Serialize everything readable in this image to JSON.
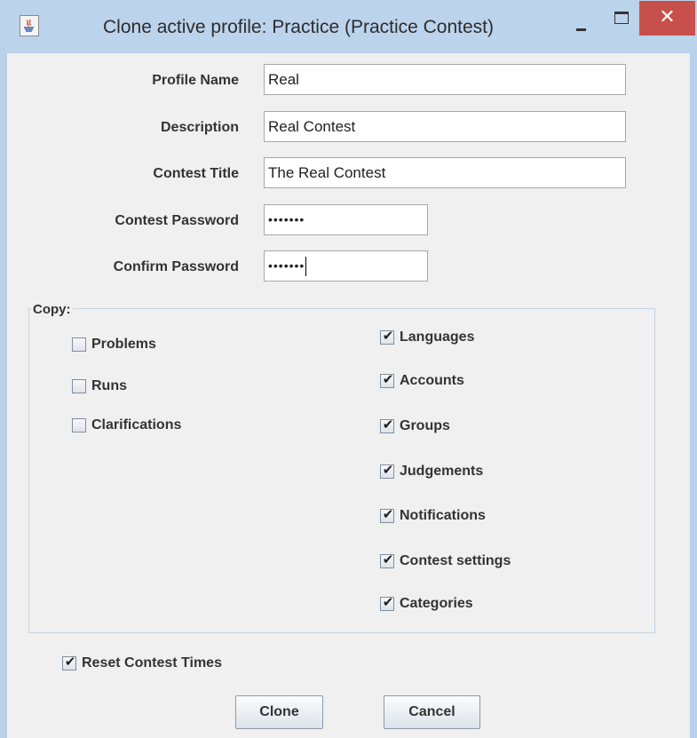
{
  "window": {
    "title": "Clone active profile: Practice (Practice Contest)",
    "close_glyph": "✕",
    "icons": [
      "java-icon",
      "minimize-icon",
      "maximize-icon",
      "close-icon"
    ]
  },
  "form": {
    "profile_name_label": "Profile Name",
    "profile_name_value": "Real",
    "description_label": "Description",
    "description_value": "Real Contest",
    "contest_title_label": "Contest Title",
    "contest_title_value": "The Real Contest",
    "contest_password_label": "Contest Password",
    "contest_password_value": "•••••••",
    "confirm_password_label": "Confirm Password",
    "confirm_password_value": "•••••••"
  },
  "copy": {
    "title": "Copy:",
    "left": [
      {
        "label": "Problems",
        "checked": false
      },
      {
        "label": "Runs",
        "checked": false
      },
      {
        "label": "Clarifications",
        "checked": false
      }
    ],
    "right": [
      {
        "label": "Languages",
        "checked": true
      },
      {
        "label": "Accounts",
        "checked": true
      },
      {
        "label": "Groups",
        "checked": true
      },
      {
        "label": "Judgements",
        "checked": true
      },
      {
        "label": "Notifications",
        "checked": true
      },
      {
        "label": "Contest settings",
        "checked": true
      },
      {
        "label": "Categories",
        "checked": true
      }
    ]
  },
  "reset": {
    "label": "Reset Contest Times",
    "checked": true
  },
  "check_glyph": "✔",
  "buttons": {
    "clone": "Clone",
    "cancel": "Cancel"
  },
  "colors": {
    "titlebar": "#bcd3ec",
    "close_button": "#c7504a",
    "dialog_background": "#f0f0f0"
  }
}
